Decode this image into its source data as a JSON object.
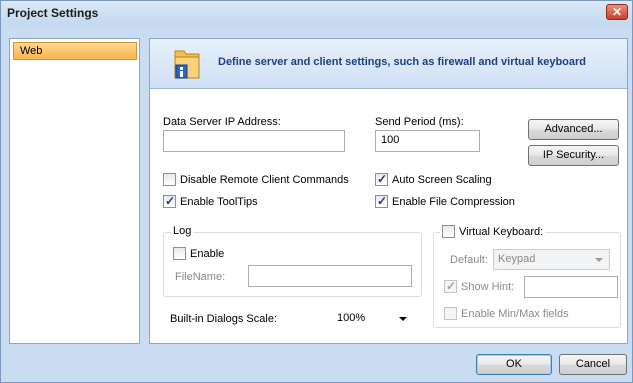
{
  "window": {
    "title": "Project Settings",
    "close_label": "✕"
  },
  "sidebar": {
    "items": [
      {
        "label": "Web"
      }
    ]
  },
  "header": {
    "text": "Define server and  client settings, such as firewall and virtual keyboard"
  },
  "fields": {
    "data_server_ip": {
      "label": "Data Server IP Address:",
      "value": ""
    },
    "send_period": {
      "label": "Send Period (ms):",
      "value": "100"
    }
  },
  "buttons": {
    "advanced": "Advanced...",
    "ip_security": "IP Security...",
    "ok": "OK",
    "cancel": "Cancel"
  },
  "checkboxes": {
    "disable_remote": {
      "label": "Disable Remote Client Commands",
      "checked": false
    },
    "auto_scaling": {
      "label": "Auto Screen Scaling",
      "checked": true
    },
    "enable_tooltips": {
      "label": "Enable ToolTips",
      "checked": true
    },
    "file_compression": {
      "label": "Enable File Compression",
      "checked": true
    }
  },
  "log": {
    "title": "Log",
    "enable_label": "Enable",
    "filename_label": "FileName:",
    "filename_value": ""
  },
  "virtual_keyboard": {
    "title": "Virtual Keyboard:",
    "default_label": "Default:",
    "default_value": "Keypad",
    "show_hint_label": "Show Hint:",
    "show_hint_value": "",
    "minmax_label": "Enable Min/Max fields"
  },
  "dialogs_scale": {
    "label": "Built-in Dialogs Scale:",
    "value": "100%"
  }
}
